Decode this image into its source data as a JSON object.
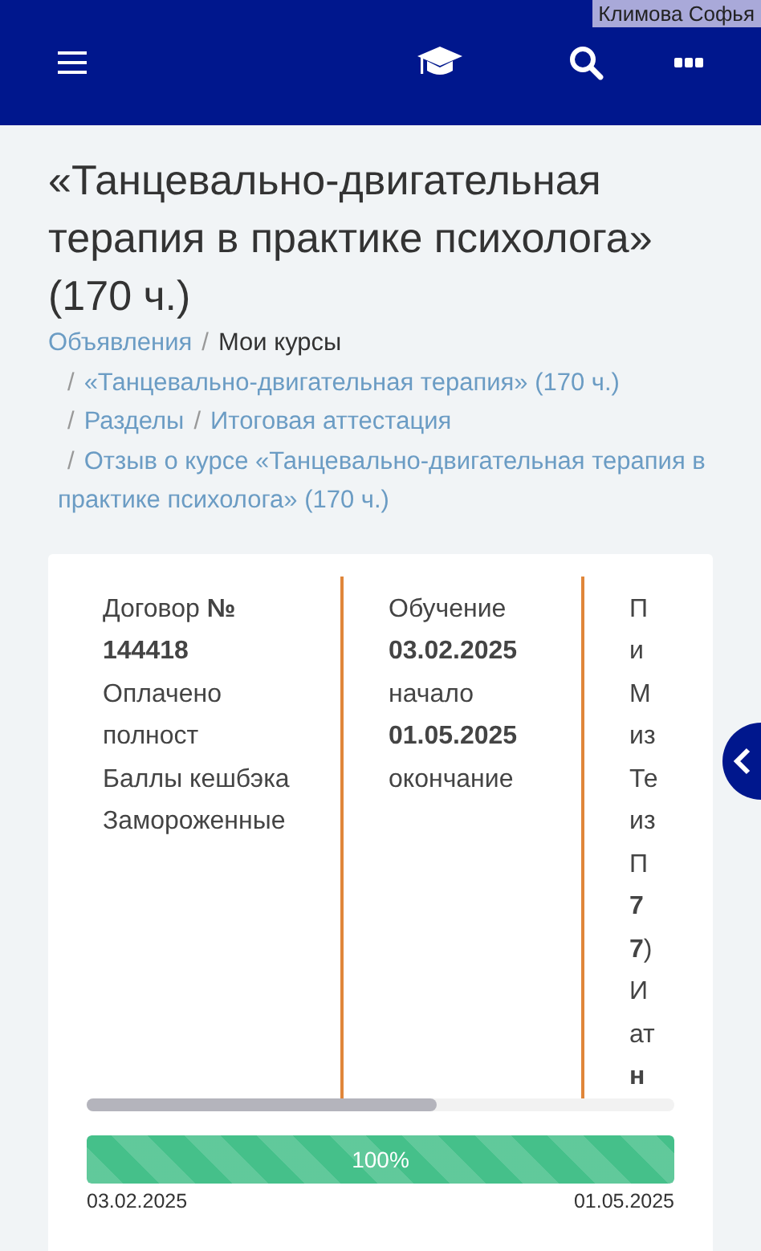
{
  "header": {
    "user_label": "Климова Софья"
  },
  "title": "«Танцевально-двигательная терапия в практике психолога» (170 ч.)",
  "breadcrumb_lines": [
    [
      {
        "label": "Объявления",
        "kind": "link"
      },
      {
        "separator": "/",
        "label": "Мои курсы",
        "kind": "current"
      }
    ],
    [
      {
        "separator": "/",
        "label": "«Танцевально-двигательная терапия» (170 ч.)",
        "kind": "link"
      }
    ],
    [
      {
        "separator": "/",
        "label": "Разделы",
        "kind": "link"
      },
      {
        "separator": "/",
        "label": "Итоговая аттестация",
        "kind": "link"
      }
    ],
    [
      {
        "separator": "/",
        "label": "Отзыв о курсе «Танцевально-двигательная терапия в практике психолога» (170 ч.)",
        "kind": "link"
      }
    ]
  ],
  "columns": [
    {
      "lines": [
        {
          "text": "Договор **№**"
        },
        {
          "text": "144418",
          "bold": true
        },
        {
          "text": "Оплачено"
        },
        {
          "text": "полност"
        },
        {
          "text": "Баллы кешбэка"
        },
        {
          "text": "Замороженные"
        }
      ]
    },
    {
      "lines": [
        {
          "text": "Обучение"
        },
        {
          "text": "03.02.2025",
          "bold": true
        },
        {
          "text": "начало"
        },
        {
          "text": "01.05.2025",
          "bold": true
        },
        {
          "text": "окончание"
        }
      ]
    },
    {
      "lines": [
        {
          "text": "П"
        },
        {
          "text": "и"
        },
        {
          "text": "М"
        },
        {
          "text": "из"
        },
        {
          "text": "Те"
        },
        {
          "text": "из"
        },
        {
          "text": "П"
        },
        {
          "text": "7",
          "bold": true
        },
        {
          "text": "**7**)"
        },
        {
          "text": "И"
        },
        {
          "text": "ат"
        },
        {
          "text": "н",
          "bold": true
        }
      ]
    }
  ],
  "progress": {
    "level": 1,
    "label": "100%",
    "start": "03.02.2025",
    "end": "01.05.2025"
  }
}
